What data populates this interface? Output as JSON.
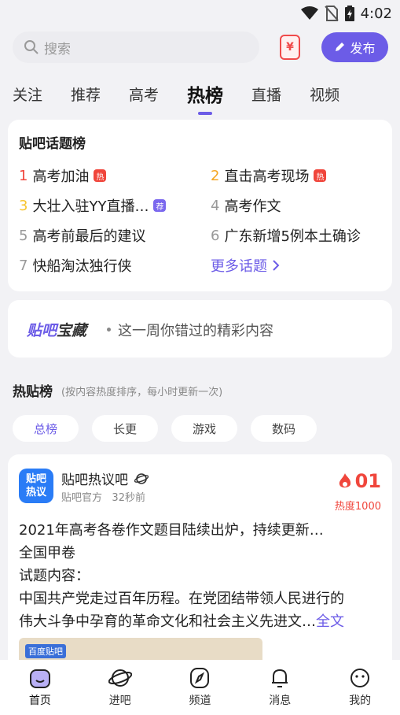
{
  "status": {
    "time": "4:02"
  },
  "search": {
    "placeholder": "搜索"
  },
  "publish_label": "发布",
  "tabs": [
    {
      "label": "关注",
      "active": false
    },
    {
      "label": "推荐",
      "active": false
    },
    {
      "label": "高考",
      "active": false
    },
    {
      "label": "热榜",
      "active": true
    },
    {
      "label": "直播",
      "active": false
    },
    {
      "label": "视频",
      "active": false
    }
  ],
  "topics": {
    "title": "贴吧话题榜",
    "items": [
      {
        "rank": "1",
        "text": "高考加油",
        "badge": "热"
      },
      {
        "rank": "2",
        "text": "直击高考现场",
        "badge": "热"
      },
      {
        "rank": "3",
        "text": "大壮入驻YY直播…",
        "badge": "荐"
      },
      {
        "rank": "4",
        "text": "高考作文",
        "badge": ""
      },
      {
        "rank": "5",
        "text": "高考前最后的建议",
        "badge": ""
      },
      {
        "rank": "6",
        "text": "广东新增5例本土确诊",
        "badge": ""
      },
      {
        "rank": "7",
        "text": "快船淘汰独行侠",
        "badge": ""
      }
    ],
    "more": "更多话题"
  },
  "treasure": {
    "brand_a": "贴吧",
    "brand_b": "宝藏",
    "desc": "这一周你错过的精彩内容"
  },
  "hot": {
    "title": "热贴榜",
    "subtitle": "(按内容热度排序，每小时更新一次)"
  },
  "filters": [
    {
      "label": "总榜",
      "active": true
    },
    {
      "label": "长更",
      "active": false
    },
    {
      "label": "游戏",
      "active": false
    },
    {
      "label": "数码",
      "active": false
    }
  ],
  "post": {
    "avatar_line1": "贴吧",
    "avatar_line2": "热议",
    "author": "贴吧热议吧",
    "source": "贴吧官方",
    "time": "32秒前",
    "rank": "01",
    "heat": "热度1000",
    "lines": [
      "2021年高考各卷作文题目陆续出炉，持续更新…",
      "全国甲卷",
      "试题内容：",
      "中国共产党走过百年历程。在党团结带领人民进行的",
      "伟大斗争中孕育的革命文化和社会主义先进文…"
    ],
    "fulltext": "全文",
    "image_tag": "百度贴吧"
  },
  "nav": [
    {
      "label": "首页",
      "icon": "home-icon"
    },
    {
      "label": "进吧",
      "icon": "planet-icon"
    },
    {
      "label": "频道",
      "icon": "compass-icon"
    },
    {
      "label": "消息",
      "icon": "bell-icon"
    },
    {
      "label": "我的",
      "icon": "face-icon"
    }
  ],
  "colors": {
    "accent": "#6c5ce7",
    "hot_red": "#f0463c",
    "rank_orange": "#f5a623",
    "rank_yellow": "#f7c531"
  }
}
